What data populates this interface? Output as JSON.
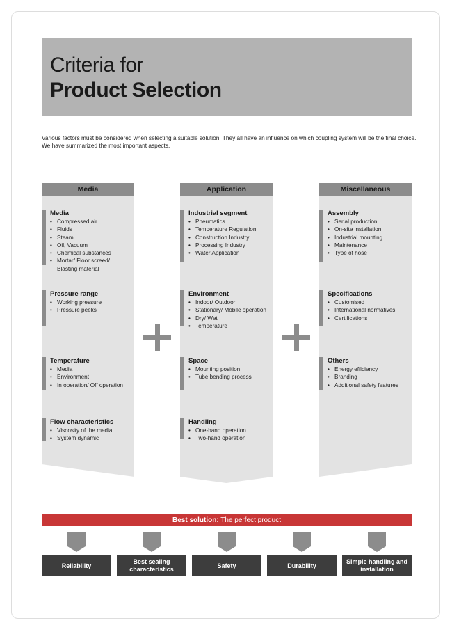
{
  "title": {
    "line1": "Criteria for",
    "line2": "Product Selection"
  },
  "intro": "Various factors must be considered when selecting a suitable solution. They all have an influence on which coupling system will be the final choice. We have summarized the most important aspects.",
  "columns": [
    {
      "header": "Media",
      "groups": [
        {
          "title": "Media",
          "items": [
            "Compressed air",
            "Fluids",
            "Steam",
            "Oil, Vacuum",
            "Chemical substances",
            "Mortar/ Floor screed/",
            "Blasting material"
          ]
        },
        {
          "title": "Pressure range",
          "items": [
            "Working pressure",
            "Pressure peeks"
          ]
        },
        {
          "title": "Temperature",
          "items": [
            "Media",
            "Environment",
            "In operation/ Off operation"
          ]
        },
        {
          "title": "Flow characteristics",
          "items": [
            "Viscosity of the media",
            "System dynamic"
          ]
        }
      ]
    },
    {
      "header": "Application",
      "groups": [
        {
          "title": "Industrial segment",
          "items": [
            "Pneumatics",
            "Temperature Regulation",
            "Construction Industry",
            "Processing Industry",
            "Water Application"
          ]
        },
        {
          "title": "Environment",
          "items": [
            "Indoor/ Outdoor",
            "Stationary/ Mobile operation",
            "Dry/ Wet",
            "Temperature"
          ]
        },
        {
          "title": "Space",
          "items": [
            "Mounting position",
            "Tube bending process"
          ]
        },
        {
          "title": "Handling",
          "items": [
            "One-hand operation",
            "Two-hand operation"
          ]
        }
      ]
    },
    {
      "header": "Miscellaneous",
      "groups": [
        {
          "title": "Assembly",
          "items": [
            "Serial production",
            "On-site installation",
            "Industrial mounting",
            "Maintenance",
            "Type of hose"
          ]
        },
        {
          "title": "Specifications",
          "items": [
            "Customised",
            "International normatives",
            "Certifications"
          ]
        },
        {
          "title": "Others",
          "items": [
            "Energy efficiency",
            "Branding",
            "Additional safety features"
          ]
        }
      ]
    }
  ],
  "best_solution": {
    "bold": "Best solution:",
    "rest": " The perfect product"
  },
  "outcomes": [
    "Reliability",
    "Best sealing characteristics",
    "Safety",
    "Durability",
    "Simple handling and installation"
  ],
  "colors": {
    "title_bg": "#b3b3b3",
    "column_bg": "#e3e3e3",
    "header_bg": "#8c8c8c",
    "accent_red": "#c83636",
    "outcome_bg": "#3d3d3d"
  }
}
